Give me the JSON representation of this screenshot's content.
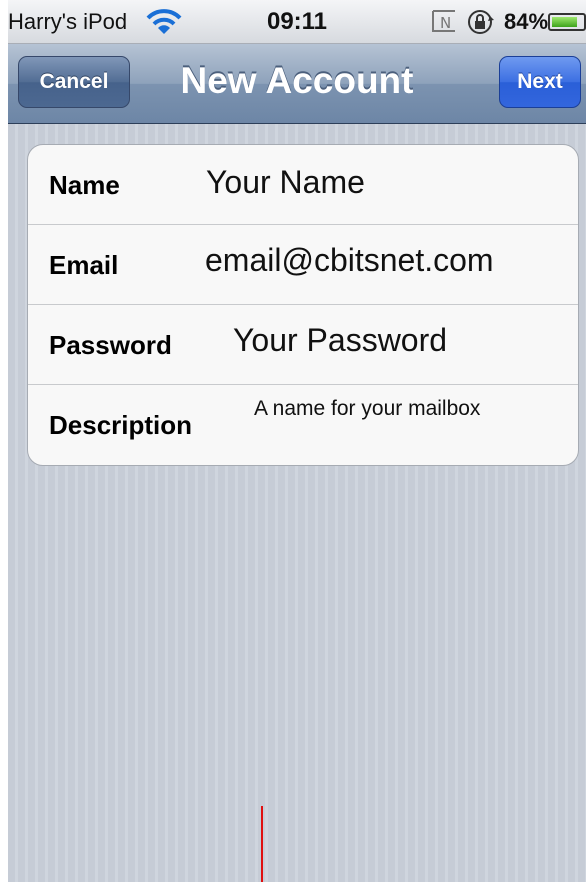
{
  "status_bar": {
    "carrier": "Harry's iPod",
    "time": "09:11",
    "battery_percent": "84%",
    "battery_level": 0.84,
    "icons": [
      "wifi-icon",
      "nfc-icon",
      "rotation-lock-icon",
      "battery-icon"
    ]
  },
  "nav": {
    "title": "New Account",
    "cancel_label": "Cancel",
    "next_label": "Next"
  },
  "form": {
    "rows": [
      {
        "label": "Name",
        "value": "Your Name"
      },
      {
        "label": "Email",
        "value": "email@cbitsnet.com"
      },
      {
        "label": "Password",
        "value": "Your Password"
      },
      {
        "label": "Description",
        "value": "A name for your mailbox"
      }
    ]
  },
  "colors": {
    "nav_bar": "#7c93b0",
    "next_button": "#3366dd",
    "text_cursor": "#e01010"
  }
}
